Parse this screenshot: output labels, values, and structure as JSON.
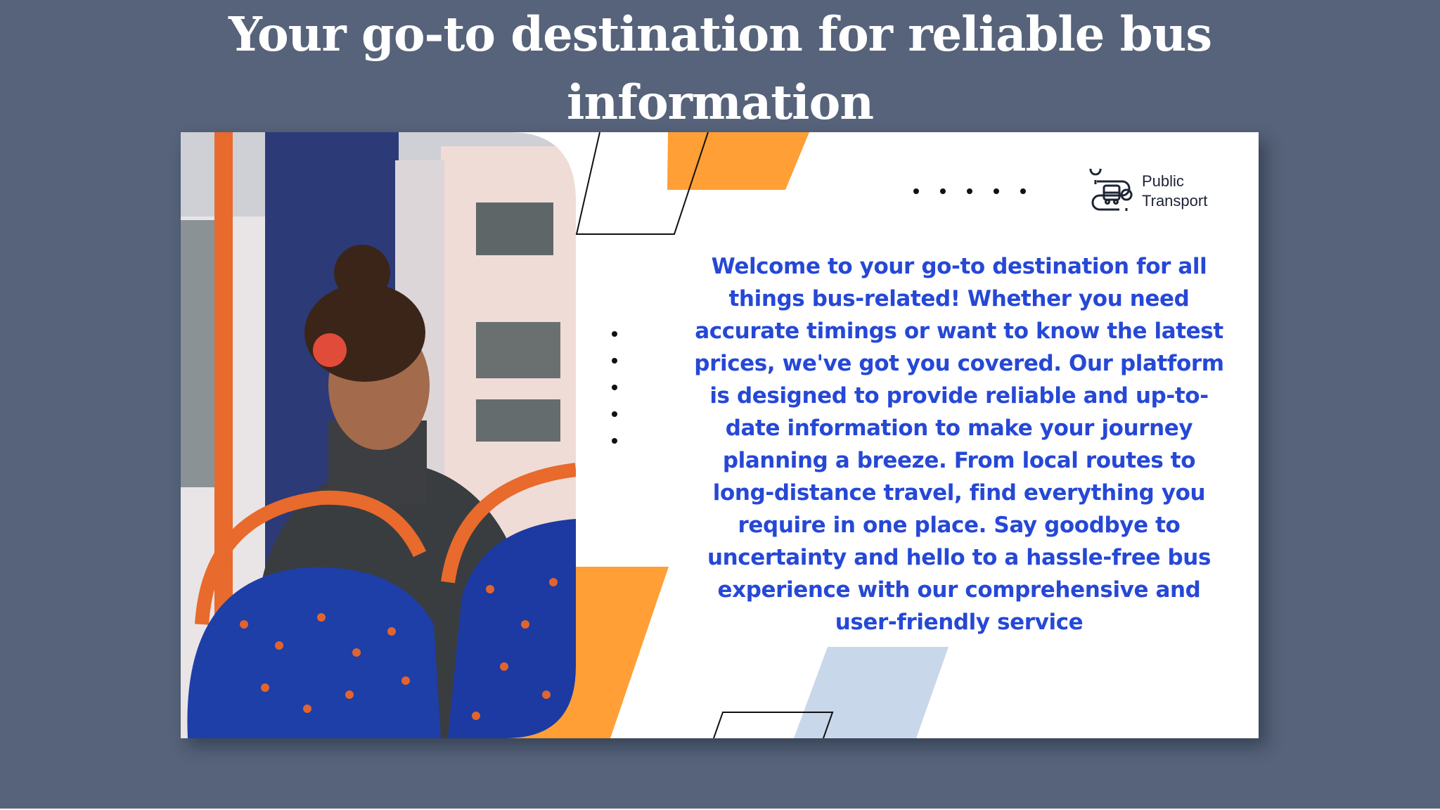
{
  "headline": {
    "line1": "Your go-to destination for reliable bus",
    "line2": "information"
  },
  "brand": {
    "line1": "Public",
    "line2": "Transport",
    "icon": "bus-route-icon"
  },
  "body": {
    "text": "Welcome to your go-to destination for all things bus-related! Whether you need accurate timings or want to know the latest prices, we've got you covered. Our platform is designed to provide reliable and up-to-date information to make your journey planning a breeze. From local routes to long-distance travel, find everything you require in one place. Say goodbye to uncertainty and hello to a hassle-free bus experience with our comprehensive and user-friendly service"
  },
  "colors": {
    "page_background": "#56637a",
    "accent_orange": "#ff9f36",
    "accent_blue_text": "#2648d6",
    "accent_light_blue": "#c8d7ea",
    "card_background": "#ffffff"
  }
}
